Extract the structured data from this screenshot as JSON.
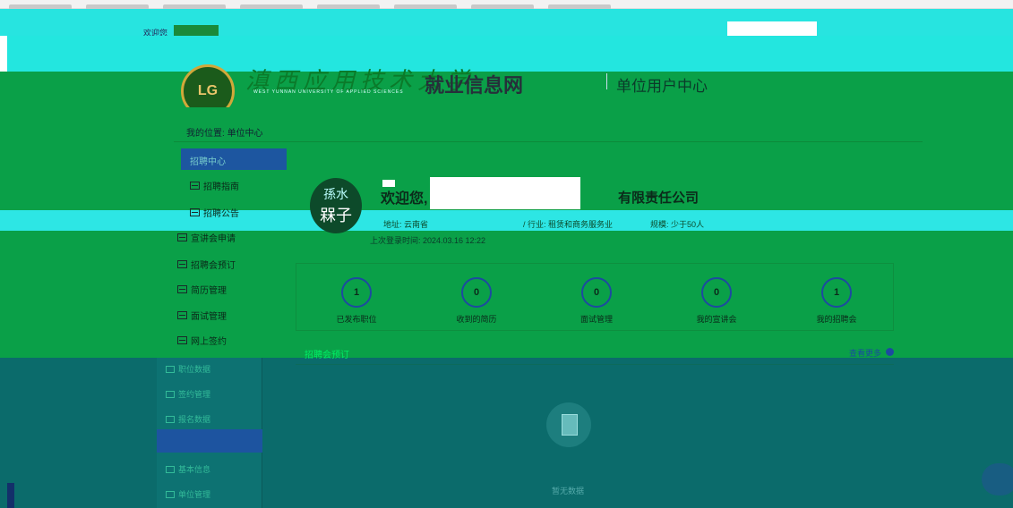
{
  "topbar": {
    "welcome": "欢迎您",
    "login_link": ""
  },
  "header": {
    "logo_text": "LG",
    "university_cn": "滇西应用技术大学",
    "university_en": "WEST YUNNAN UNIVERSITY OF APPLIED SCIENCES",
    "site_name": "就业信息网",
    "center_name": "单位用户中心"
  },
  "breadcrumb": {
    "label": "我的位置:",
    "current": "单位中心"
  },
  "sidebar": {
    "section_title": "招聘中心",
    "items": [
      {
        "label": "招聘指南",
        "icon": "list-icon"
      },
      {
        "label": "招聘公告",
        "icon": "list-icon"
      },
      {
        "label": "宣讲会申请",
        "icon": "list-icon"
      },
      {
        "label": "招聘会预订",
        "icon": "list-icon"
      },
      {
        "label": "简历管理",
        "icon": "list-icon"
      },
      {
        "label": "面试管理",
        "icon": "list-icon"
      },
      {
        "label": "网上签约",
        "icon": "list-icon"
      }
    ],
    "lower_items": [
      {
        "label": "职位数据"
      },
      {
        "label": "签约管理"
      },
      {
        "label": "报名数据"
      },
      {
        "label": "基本信息"
      },
      {
        "label": "单位管理"
      }
    ]
  },
  "profile": {
    "avatar_line1": "孫水",
    "avatar_line2": "槑子",
    "welcome_prefix": "欢迎您,",
    "name_suffix": "有限责任公司",
    "address": "地址: 云南省",
    "industry": "/ 行业: 租赁和商务服务业",
    "scale": "规模: 少于50人",
    "last_login": "上次登录时间: 2024.03.16 12:22"
  },
  "stats": [
    {
      "value": "1",
      "label": "已发布职位"
    },
    {
      "value": "0",
      "label": "收到的简历"
    },
    {
      "value": "0",
      "label": "面试管理"
    },
    {
      "value": "0",
      "label": "我的宣讲会"
    },
    {
      "value": "1",
      "label": "我的招聘会"
    }
  ],
  "tabs": {
    "active": "招聘会预订",
    "more": "查看更多"
  },
  "empty": {
    "text": "暂无数据"
  }
}
